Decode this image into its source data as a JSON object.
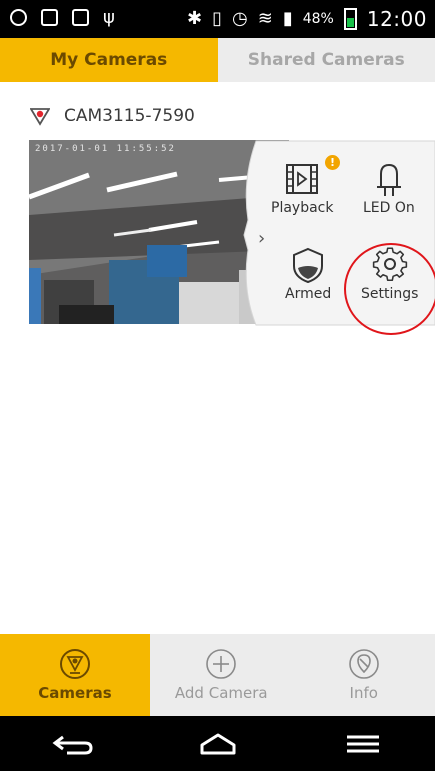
{
  "status_bar": {
    "battery": "48%",
    "time": "12:00"
  },
  "tabs": [
    {
      "label": "My Cameras",
      "active": true
    },
    {
      "label": "Shared Cameras",
      "active": false
    }
  ],
  "camera": {
    "name": "CAM3115-7590",
    "timestamp": "2017-01-01 11:55:52"
  },
  "actions": {
    "playback": {
      "label": "Playback",
      "badge": "!"
    },
    "led": {
      "label": "LED On"
    },
    "armed": {
      "label": "Armed"
    },
    "settings": {
      "label": "Settings"
    }
  },
  "bottom_nav": [
    {
      "label": "Cameras",
      "icon": "camera-icon",
      "active": true
    },
    {
      "label": "Add Camera",
      "icon": "plus-circle-icon",
      "active": false
    },
    {
      "label": "Info",
      "icon": "info-icon",
      "active": false
    }
  ],
  "colors": {
    "accent": "#f5b800",
    "accent_text": "#6b4a00",
    "tab_inactive": "#ececec",
    "highlight": "#e0151a"
  }
}
